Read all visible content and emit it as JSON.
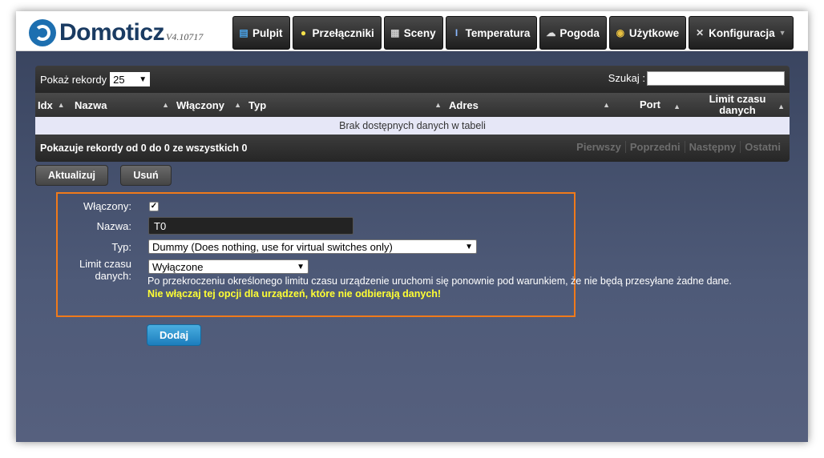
{
  "header": {
    "logo_text": "Domoticz",
    "version": "V4.10717",
    "nav": [
      {
        "label": "Pulpit",
        "icon": "dashboard-icon",
        "glyph": "▤"
      },
      {
        "label": "Przełączniki",
        "icon": "lightbulb-icon",
        "glyph": "💡"
      },
      {
        "label": "Sceny",
        "icon": "clapperboard-icon",
        "glyph": "🎬"
      },
      {
        "label": "Temperatura",
        "icon": "thermometer-icon",
        "glyph": "🌡"
      },
      {
        "label": "Pogoda",
        "icon": "cloud-icon",
        "glyph": "☁"
      },
      {
        "label": "Użytkowe",
        "icon": "utility-icon",
        "glyph": "⚙"
      },
      {
        "label": "Konfiguracja",
        "icon": "wrench-icon",
        "glyph": "🔧"
      }
    ]
  },
  "table": {
    "show_records_label": "Pokaż rekordy",
    "show_records_value": "25",
    "search_label": "Szukaj :",
    "columns": [
      "Idx",
      "Nazwa",
      "Włączony",
      "Typ",
      "Adres",
      "Port",
      "Limit czasu danych"
    ],
    "empty_message": "Brak dostępnych danych w tabeli",
    "info": "Pokazuje rekordy od 0 do 0 ze wszystkich 0",
    "pager": [
      "Pierwszy",
      "Poprzedni",
      "Następny",
      "Ostatni"
    ]
  },
  "actions": {
    "update_label": "Aktualizuj",
    "delete_label": "Usuń"
  },
  "form": {
    "enabled_label": "Włączony:",
    "enabled_checked": true,
    "name_label": "Nazwa:",
    "name_value": "T0",
    "type_label": "Typ:",
    "type_value": "Dummy (Does nothing, use for virtual switches only)",
    "timeout_label_1": "Limit czasu",
    "timeout_label_2": "danych:",
    "timeout_value": "Wyłączone",
    "timeout_note": "Po przekroczeniu określonego limitu czasu urządzenie uruchomi się ponownie pod warunkiem, że nie będą przesyłane żadne dane.",
    "timeout_warning": "Nie włączaj tej opcji dla urządzeń, które nie odbierają danych!",
    "add_label": "Dodaj"
  },
  "colors": {
    "accent": "#1d6fb0",
    "highlight_border": "#f07a1a",
    "warning_text": "#ffff33",
    "add_button": "#2b8fd0"
  }
}
